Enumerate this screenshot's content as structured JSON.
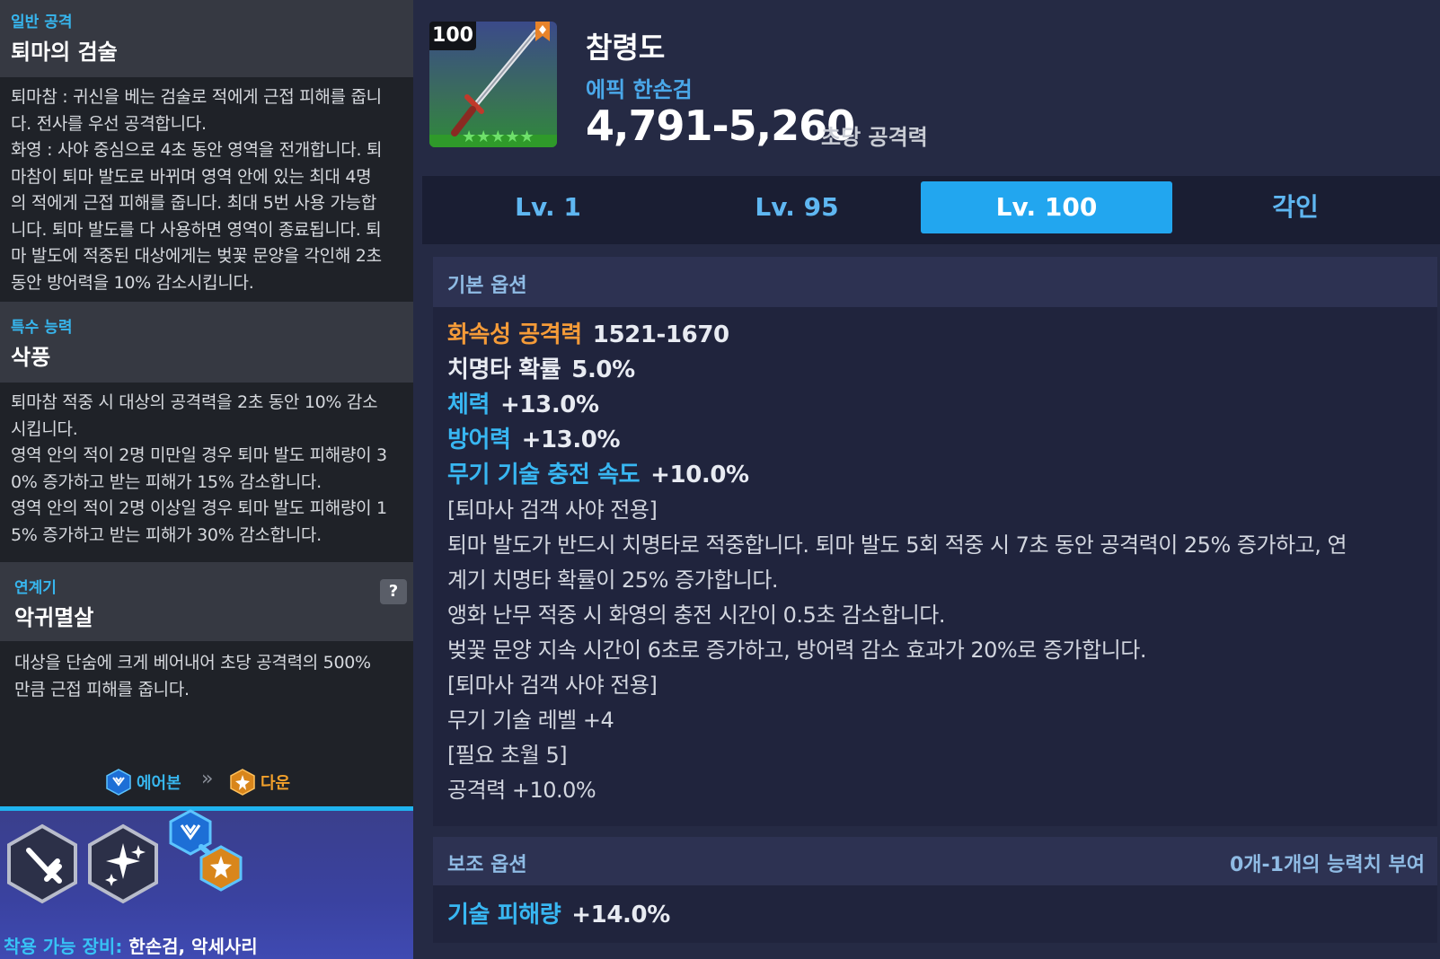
{
  "left": {
    "normal_attack": {
      "label": "일반 공격",
      "title": "퇴마의 검술",
      "text": "퇴마참 : 귀신을 베는 검술로 적에게 근접 피해를 줍니\n다. 전사를 우선 공격합니다.\n화영 : 사야 중심으로 4초 동안 영역을 전개합니다. 퇴\n마참이 퇴마 발도로 바뀌며 영역 안에 있는 최대 4명\n의 적에게 근접 피해를 줍니다. 최대 5번 사용 가능합\n니다. 퇴마 발도를 다 사용하면 영역이 종료됩니다. 퇴\n마 발도에 적중된 대상에게는 벚꽃 문양을 각인해 2초\n동안 방어력을 10% 감소시킵니다."
    },
    "special_ability": {
      "label": "특수 능력",
      "title": "삭풍",
      "text": "퇴마참 적중 시 대상의 공격력을 2초 동안 10% 감소\n시킵니다.\n영역 안의 적이 2명 미만일 경우 퇴마 발도 피해량이 3\n0% 증가하고 받는 피해가 15% 감소합니다.\n영역 안의 적이 2명 이상일 경우 퇴마 발도 피해량이 1\n5% 증가하고 받는 피해가 30% 감소합니다."
    },
    "combo": {
      "label": "연계기",
      "title": "악귀멸살",
      "help": "?",
      "text": "대상을 단숨에 크게 베어내어 초당 공격력의 500%\n만큼 근접 피해를 줍니다."
    },
    "combo_chain": {
      "from": "에어본",
      "to": "다운",
      "from_icon": "airborne-icon",
      "to_icon": "down-icon"
    },
    "equip": {
      "label": "착용 가능 장비:",
      "value": "한손검, 악세사리"
    }
  },
  "item": {
    "level_badge": "100",
    "name": "참령도",
    "type": "에픽 한손검",
    "attack": "4,791-5,260",
    "attack_label": "초당 공격력",
    "stars": "★★★★★"
  },
  "tabs": [
    {
      "label": "Lv. 1"
    },
    {
      "label": "Lv. 95"
    },
    {
      "label": "Lv. 100",
      "active": true
    },
    {
      "label": "각인"
    }
  ],
  "basic_options": {
    "title": "기본 옵션",
    "stats": [
      {
        "key": "화속성 공격력",
        "value": "1521-1670"
      },
      {
        "key": "치명타 확률",
        "value": "5.0%"
      },
      {
        "key": "체력",
        "value": "+13.0%"
      },
      {
        "key": "방어력",
        "value": "+13.0%"
      },
      {
        "key": "무기 기술 충전 속도",
        "value": "+10.0%"
      }
    ],
    "lines": [
      "[퇴마사 검객 사야 전용]",
      "퇴마 발도가 반드시 치명타로 적중합니다. 퇴마 발도 5회 적중 시 7초 동안 공격력이 25% 증가하고, 연",
      "계기 치명타 확률이 25% 증가합니다.",
      "앵화 난무 적중 시 화영의 충전 시간이 0.5초 감소합니다.",
      "벚꽃 문양 지속 시간이 6초로 증가하고, 방어력 감소 효과가 20%로 증가합니다.",
      "[퇴마사 검객 사야 전용]",
      "무기 기술 레벨 +4",
      "[필요 초월 5]",
      "공격력 +10.0%"
    ]
  },
  "sub_options": {
    "title": "보조 옵션",
    "note": "0개-1개의 능력치 부여",
    "stats": [
      {
        "key": "기술 피해량",
        "value": "+14.0%"
      }
    ]
  },
  "colors": {
    "accent_blue": "#22a6ef",
    "label_cyan": "#37b6ee",
    "fire_orange": "#f59b38"
  }
}
